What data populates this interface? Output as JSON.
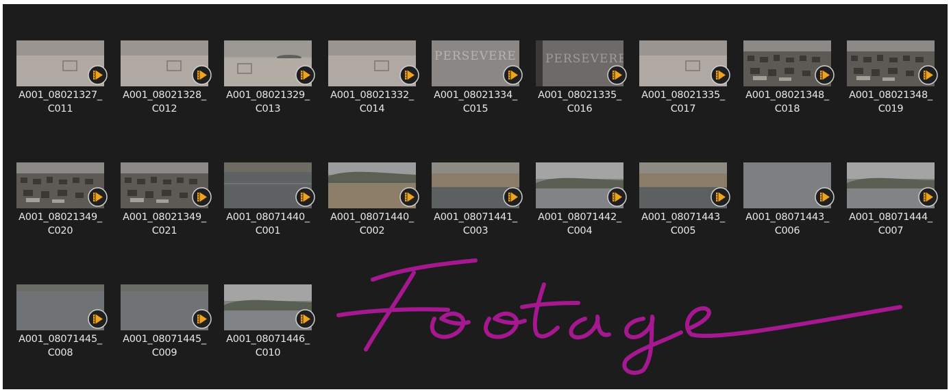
{
  "signature_text": "Footage",
  "accent_color": "#a5188f",
  "play_icon": "video-play-icon",
  "files": [
    {
      "line1": "A001_08021327_",
      "line2": "C011",
      "scene": "beach"
    },
    {
      "line1": "A001_08021328_",
      "line2": "C012",
      "scene": "beach"
    },
    {
      "line1": "A001_08021329_",
      "line2": "C013",
      "scene": "beach-island"
    },
    {
      "line1": "A001_08021332_",
      "line2": "C014",
      "scene": "beach"
    },
    {
      "line1": "A001_08021334_",
      "line2": "C015",
      "scene": "stone",
      "caption": "PERSEVERE"
    },
    {
      "line1": "A001_08021335_",
      "line2": "C016",
      "scene": "stone-dark",
      "caption": "PERSEVERE"
    },
    {
      "line1": "A001_08021335_",
      "line2": "C017",
      "scene": "beach"
    },
    {
      "line1": "A001_08021348_",
      "line2": "C018",
      "scene": "cemetery"
    },
    {
      "line1": "A001_08021348_",
      "line2": "C019",
      "scene": "cemetery"
    },
    {
      "line1": "A001_08021349_",
      "line2": "C020",
      "scene": "cemetery"
    },
    {
      "line1": "A001_08021349_",
      "line2": "C021",
      "scene": "cemetery"
    },
    {
      "line1": "A001_08071440_",
      "line2": "C001",
      "scene": "lake"
    },
    {
      "line1": "A001_08071440_",
      "line2": "C002",
      "scene": "marsh"
    },
    {
      "line1": "A001_08071441_",
      "line2": "C003",
      "scene": "marsh-pond"
    },
    {
      "line1": "A001_08071442_",
      "line2": "C004",
      "scene": "lake-hills"
    },
    {
      "line1": "A001_08071443_",
      "line2": "C005",
      "scene": "marsh-pond"
    },
    {
      "line1": "A001_08071443_",
      "line2": "C006",
      "scene": "grey"
    },
    {
      "line1": "A001_08071444_",
      "line2": "C007",
      "scene": "lake-hills"
    },
    {
      "line1": "A001_08071445_",
      "line2": "C008",
      "scene": "water"
    },
    {
      "line1": "A001_08071445_",
      "line2": "C009",
      "scene": "water"
    },
    {
      "line1": "A001_08071446_",
      "line2": "C010",
      "scene": "lake-hills"
    }
  ]
}
